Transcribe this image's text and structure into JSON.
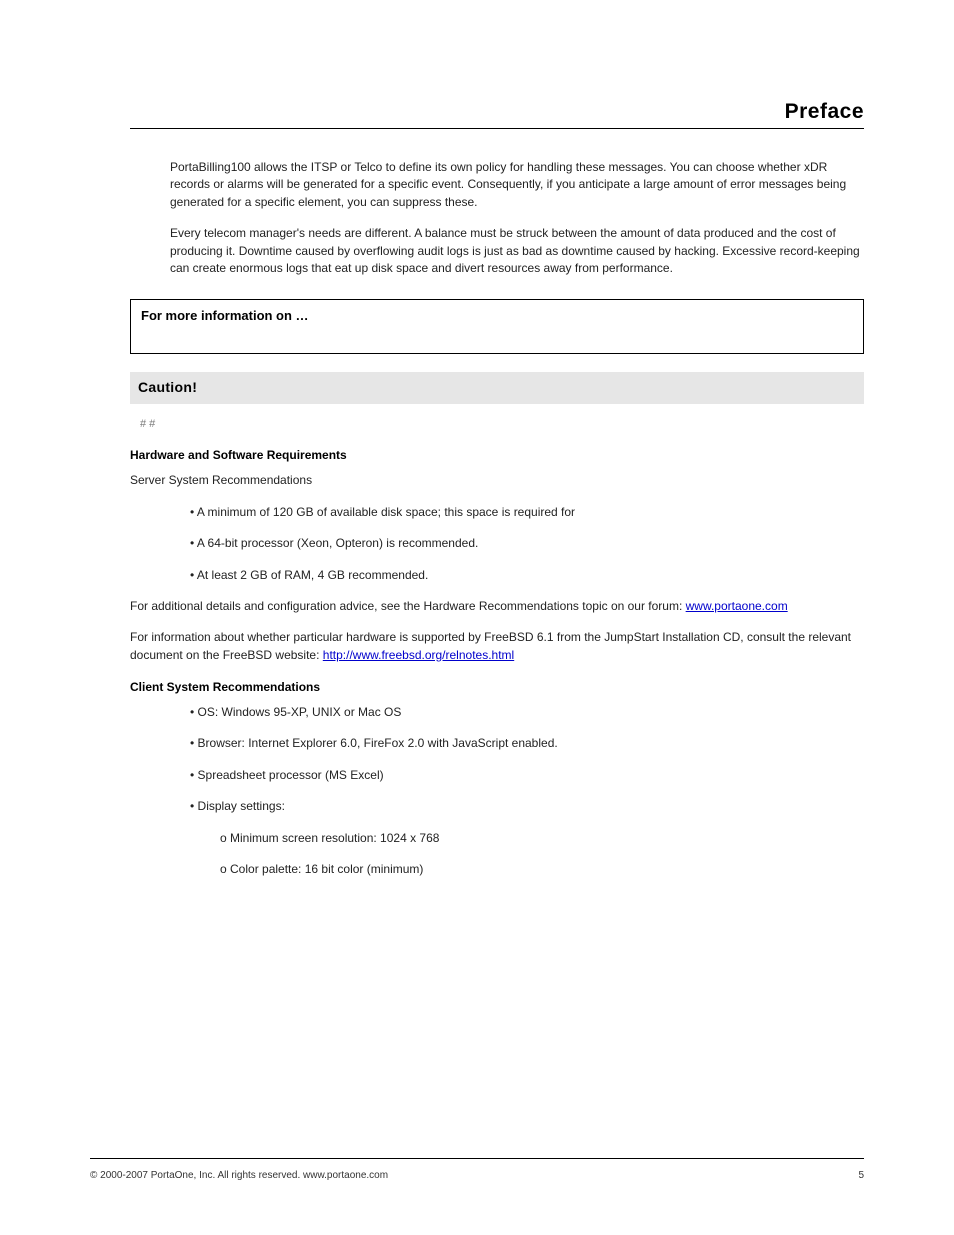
{
  "header": {
    "title": "Preface"
  },
  "paragraphs": {
    "p1": "PortaBilling100 allows the ITSP or Telco to define its own policy for handling these messages. You can choose whether xDR records or alarms will be generated for a specific event. Consequently, if you anticipate a large amount of error messages being generated for a specific element, you can suppress these.",
    "p2": "Every telecom manager's needs are different. A balance must be struck between the amount of data produced and the cost of producing it. Downtime caused by overflowing audit logs is just as bad as downtime caused by hacking. Excessive record-keeping can create enormous logs that eat up disk space and divert resources away from performance."
  },
  "infoBox": {
    "title": "For more information on …"
  },
  "caution": {
    "label": "Caution!"
  },
  "hash": "# #",
  "section": {
    "heading": "Hardware and Software Requirements",
    "server": "Server System Recommendations",
    "items": {
      "i1": "• A minimum of 120 GB of available disk space; this space is required for",
      "i2": "• A 64-bit processor (Xeon, Opteron) is recommended.",
      "i3": "• At least 2 GB of RAM, 4 GB recommended."
    },
    "more": "For additional details and configuration advice, see the Hardware Recommendations topic on our forum: ",
    "forum_url": "www.portaone.com",
    "advice": "For information about whether particular hardware is supported by FreeBSD 6.1 from the JumpStart Installation CD, consult the relevant document on the FreeBSD website: ",
    "freebsd_url": "http://www.freebsd.org/relnotes.html"
  },
  "client": {
    "heading": "Client System Recommendations",
    "items": {
      "c1": "• OS: Windows 95-XP, UNIX or Mac OS",
      "c2": "• Browser: Internet Explorer 6.0, FireFox 2.0 with JavaScript enabled.",
      "c3": "• Spreadsheet processor (MS Excel)",
      "c4": "• Display settings:",
      "c4a": "o Minimum screen resolution: 1024 x 768",
      "c4b": "o Color palette: 16 bit color (minimum)"
    }
  },
  "footer": {
    "left": "© 2000-2007 PortaOne, Inc. All rights reserved. www.portaone.com",
    "right": "5"
  }
}
